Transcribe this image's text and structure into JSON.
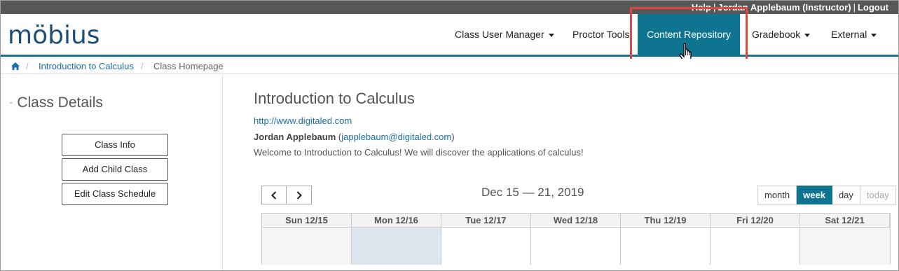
{
  "topbar": {
    "help": "Help",
    "sep": "|",
    "user": "Jordan Applebaum (Instructor)",
    "logout": "Logout"
  },
  "logo": "möbius",
  "nav": {
    "items": [
      {
        "label": "Class User Manager",
        "dropdown": true
      },
      {
        "label": "Proctor Tools",
        "dropdown": false
      },
      {
        "label": "Content Repository",
        "dropdown": false,
        "active": true
      },
      {
        "label": "Gradebook",
        "dropdown": true
      },
      {
        "label": "External",
        "dropdown": true
      }
    ]
  },
  "breadcrumb": {
    "home_icon": "home-icon",
    "items": [
      "Introduction to Calculus",
      "Class Homepage"
    ],
    "sep": "/"
  },
  "sidebar": {
    "title": "Class Details",
    "collapse_symbol": "-",
    "buttons": [
      "Class Info",
      "Add Child Class",
      "Edit Class Schedule"
    ]
  },
  "main": {
    "title": "Introduction to Calculus",
    "url": "http://www.digitaled.com",
    "owner_name": "Jordan Applebaum",
    "owner_email": "japplebaum@digitaled.com",
    "welcome": "Welcome to Introduction to Calculus! We will discover the applications of calculus!"
  },
  "calendar": {
    "prev": "‹",
    "next": "›",
    "range": "Dec 15 — 21, 2019",
    "views": [
      "month",
      "week",
      "day",
      "today"
    ],
    "active_view": "week",
    "days": [
      "Sun 12/15",
      "Mon 12/16",
      "Tue 12/17",
      "Wed 12/18",
      "Thu 12/19",
      "Fri 12/20",
      "Sat 12/21"
    ]
  },
  "colors": {
    "accent": "#0e7490",
    "highlight": "#e04848",
    "link": "#1b6fa8"
  }
}
